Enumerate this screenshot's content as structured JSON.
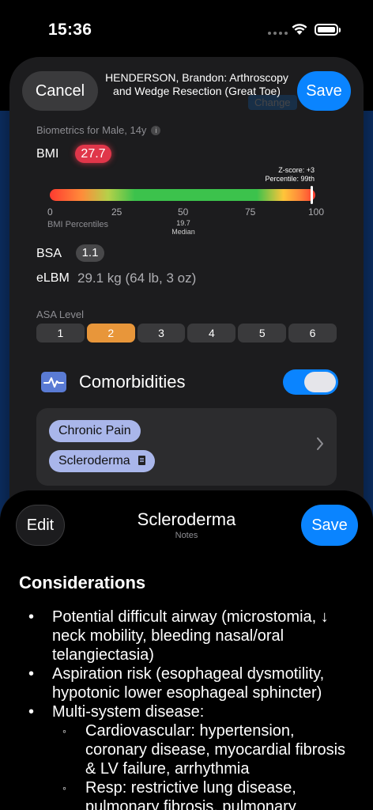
{
  "status_bar": {
    "time": "15:36"
  },
  "back_sheet": {
    "cancel_label": "Cancel",
    "title": "HENDERSON, Brandon: Arthroscopy and Wedge Resection (Great Toe)",
    "save_label": "Save",
    "biometrics_label": "Biometrics for Male, 14y",
    "bmi": {
      "label": "BMI",
      "value": "27.7",
      "zscore_text": "Z-score: +3",
      "percentile_text": "Percentile: 99th",
      "percentile": 99,
      "ticks": [
        "0",
        "25",
        "50",
        "75",
        "100"
      ],
      "axis_label": "BMI Percentiles",
      "median_value": "19.7",
      "median_label": "Median"
    },
    "bsa": {
      "label": "BSA",
      "value": "1.1"
    },
    "elbm": {
      "label": "eLBM",
      "value": "29.1 kg (64 lb, 3 oz)"
    },
    "asa": {
      "label": "ASA Level",
      "options": [
        "1",
        "2",
        "3",
        "4",
        "5",
        "6"
      ],
      "selected": "2"
    },
    "comorbidities": {
      "title": "Comorbidities",
      "toggle_on": true,
      "items": [
        {
          "label": "Chronic Pain",
          "has_note": false
        },
        {
          "label": "Scleroderma",
          "has_note": true
        }
      ]
    }
  },
  "notes_sheet": {
    "edit_label": "Edit",
    "title": "Scleroderma",
    "subtitle": "Notes",
    "save_label": "Save",
    "heading": "Considerations",
    "bullets": [
      "Potential difficult airway (microstomia, ↓ neck mobility, bleeding nasal/oral telangiectasia)",
      "Aspiration risk (esophageal dysmotility, hypotonic lower esophageal sphincter)",
      "Multi-system disease:"
    ],
    "sub_bullets": [
      "Cardiovascular: hypertension, coronary disease, myocardial fibrosis & LV failure, arrhythmia",
      "Resp: restrictive lung disease, pulmonary fibrosis, pulmonary"
    ]
  },
  "colors": {
    "accent": "#0a84ff",
    "bmi_badge": "#e0364a",
    "asa_selected": "#e8963a",
    "chip": "#a9b6ea",
    "comorbidity_icon": "#5a7bd4"
  }
}
